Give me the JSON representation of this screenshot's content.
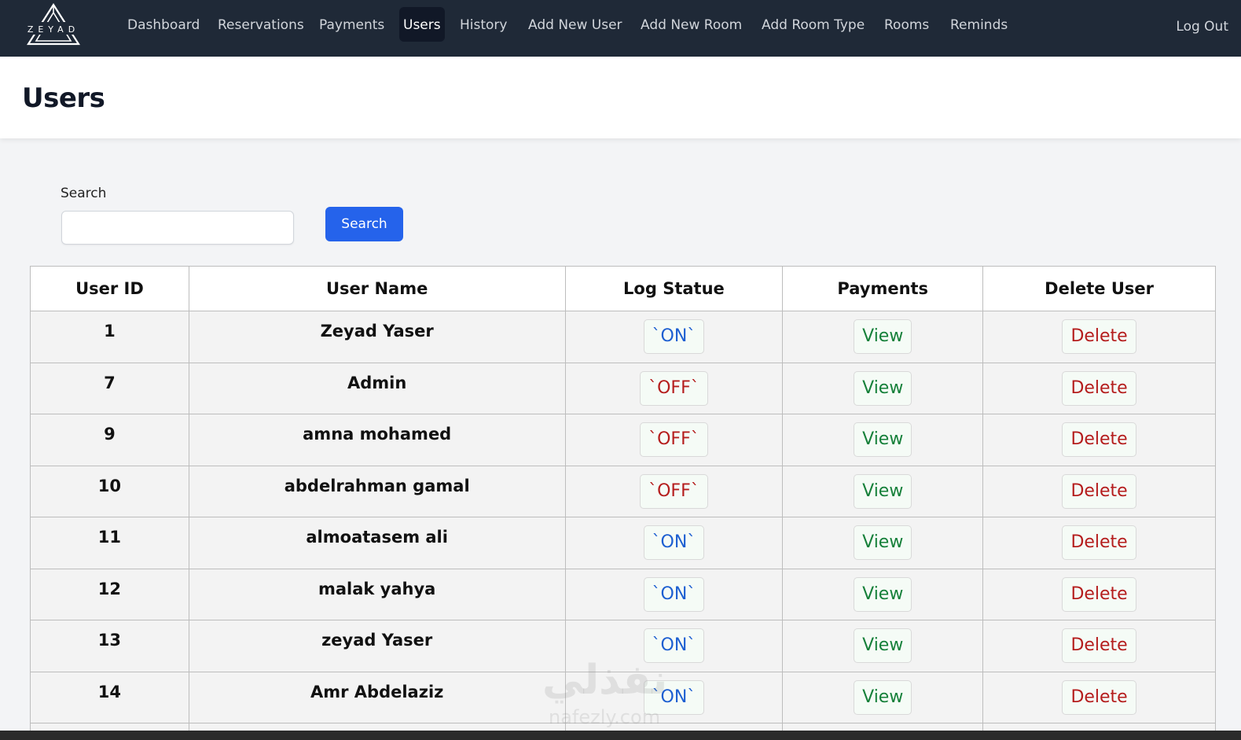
{
  "nav": {
    "logo_text": "ZEYAD",
    "items": [
      {
        "label": "Dashboard"
      },
      {
        "label": "Reservations"
      },
      {
        "label": "Payments"
      },
      {
        "label": "Users"
      },
      {
        "label": "History"
      },
      {
        "label": "Add New User"
      },
      {
        "label": "Add New Room"
      },
      {
        "label": "Add Room Type"
      },
      {
        "label": "Rooms"
      },
      {
        "label": "Reminds"
      }
    ],
    "active": "Users",
    "logout_label": "Log Out"
  },
  "page": {
    "title": "Users"
  },
  "search": {
    "label": "Search",
    "value": "",
    "placeholder": "",
    "button_label": "Search"
  },
  "table": {
    "headers": [
      "User ID",
      "User Name",
      "Log Statue",
      "Payments",
      "Delete User"
    ],
    "rows": [
      {
        "id": "1",
        "name": "Zeyad Yaser",
        "status": "`ON`",
        "status_on": true,
        "payments": "View",
        "delete": "Delete"
      },
      {
        "id": "7",
        "name": "Admin",
        "status": "`OFF`",
        "status_on": false,
        "payments": "View",
        "delete": "Delete"
      },
      {
        "id": "9",
        "name": "amna mohamed",
        "status": "`OFF`",
        "status_on": false,
        "payments": "View",
        "delete": "Delete"
      },
      {
        "id": "10",
        "name": "abdelrahman gamal",
        "status": "`OFF`",
        "status_on": false,
        "payments": "View",
        "delete": "Delete"
      },
      {
        "id": "11",
        "name": "almoatasem ali",
        "status": "`ON`",
        "status_on": true,
        "payments": "View",
        "delete": "Delete"
      },
      {
        "id": "12",
        "name": "malak yahya",
        "status": "`ON`",
        "status_on": true,
        "payments": "View",
        "delete": "Delete"
      },
      {
        "id": "13",
        "name": "zeyad Yaser",
        "status": "`ON`",
        "status_on": true,
        "payments": "View",
        "delete": "Delete"
      },
      {
        "id": "14",
        "name": "Amr Abdelaziz",
        "status": "`ON`",
        "status_on": true,
        "payments": "View",
        "delete": "Delete"
      }
    ]
  },
  "watermark": {
    "text": "نفذلي",
    "sub": "nafezly.com"
  },
  "colors": {
    "navbar": "#1f2937",
    "active_tab": "#111827",
    "primary": "#2563eb",
    "on": "#1d5fd1",
    "off": "#b51d1d",
    "view": "#16803a",
    "delete": "#b51d1d"
  }
}
